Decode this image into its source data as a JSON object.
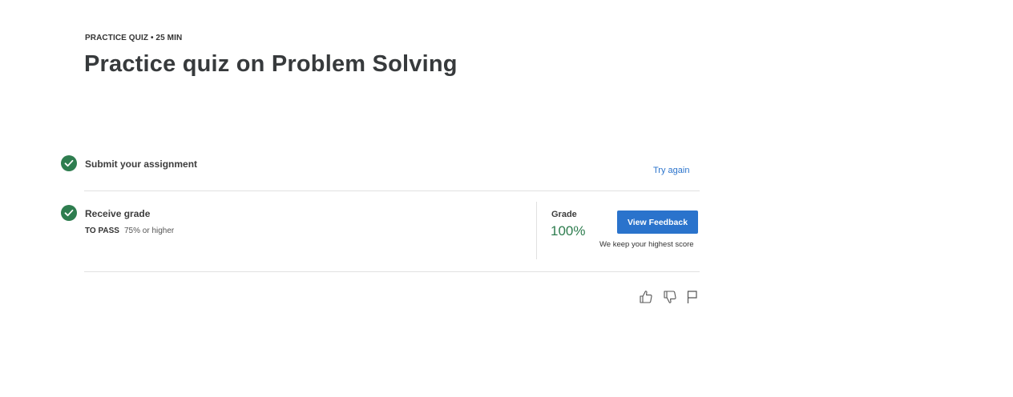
{
  "header": {
    "eyebrow": "PRACTICE QUIZ • 25 MIN",
    "title": "Practice quiz on Problem Solving"
  },
  "steps": [
    {
      "label": "Submit your assignment",
      "status": "complete",
      "action_label": "Try again"
    },
    {
      "label": "Receive grade",
      "status": "complete",
      "pass_key": "TO PASS",
      "pass_value": "75% or higher"
    }
  ],
  "grade": {
    "label": "Grade",
    "value": "100%",
    "button_label": "View Feedback",
    "note": "We keep your highest score"
  },
  "reactions": {
    "icons": [
      "thumbs-up-icon",
      "thumbs-down-icon",
      "flag-icon"
    ]
  },
  "colors": {
    "accent": "#2a73cc",
    "success": "#2e7d4f"
  }
}
